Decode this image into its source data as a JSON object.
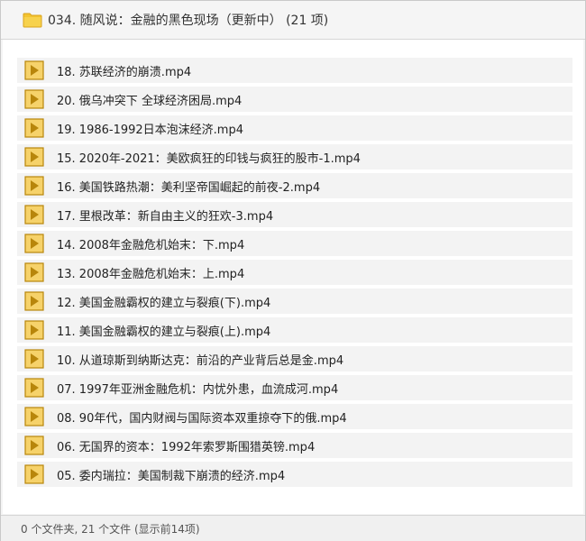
{
  "header": {
    "title": "034. 随风说：金融的黑色现场（更新中） (21 项)",
    "icon": "folder-icon"
  },
  "colors": {
    "folder": "#f3c431",
    "folder_dark": "#d9a21b",
    "video_icon_bg": "#f6d26a",
    "video_icon_border": "#b8860b",
    "video_play": "#b8860b"
  },
  "files": [
    {
      "name": "18. 苏联经济的崩溃.mp4",
      "icon": "video-file-icon"
    },
    {
      "name": "20. 俄乌冲突下 全球经济困局.mp4",
      "icon": "video-file-icon"
    },
    {
      "name": "19. 1986-1992日本泡沫经济.mp4",
      "icon": "video-file-icon"
    },
    {
      "name": "15. 2020年-2021：美欧疯狂的印钱与疯狂的股市-1.mp4",
      "icon": "video-file-icon"
    },
    {
      "name": "16. 美国铁路热潮：美利坚帝国崛起的前夜-2.mp4",
      "icon": "video-file-icon"
    },
    {
      "name": "17. 里根改革：新自由主义的狂欢-3.mp4",
      "icon": "video-file-icon"
    },
    {
      "name": "14. 2008年金融危机始末：下.mp4",
      "icon": "video-file-icon"
    },
    {
      "name": "13. 2008年金融危机始末：上.mp4",
      "icon": "video-file-icon"
    },
    {
      "name": "12. 美国金融霸权的建立与裂痕(下).mp4",
      "icon": "video-file-icon"
    },
    {
      "name": "11. 美国金融霸权的建立与裂痕(上).mp4",
      "icon": "video-file-icon"
    },
    {
      "name": "10. 从道琼斯到纳斯达克：前沿的产业背后总是金.mp4",
      "icon": "video-file-icon"
    },
    {
      "name": "07. 1997年亚洲金融危机：内忧外患，血流成河.mp4",
      "icon": "video-file-icon"
    },
    {
      "name": "08. 90年代，国内财阀与国际资本双重掠夺下的俄.mp4",
      "icon": "video-file-icon"
    },
    {
      "name": "06. 无国界的资本：1992年索罗斯围猎英镑.mp4",
      "icon": "video-file-icon"
    },
    {
      "name": "05. 委内瑞拉：美国制裁下崩溃的经济.mp4",
      "icon": "video-file-icon"
    }
  ],
  "status": {
    "text": "0 个文件夹, 21 个文件 (显示前14项)"
  }
}
